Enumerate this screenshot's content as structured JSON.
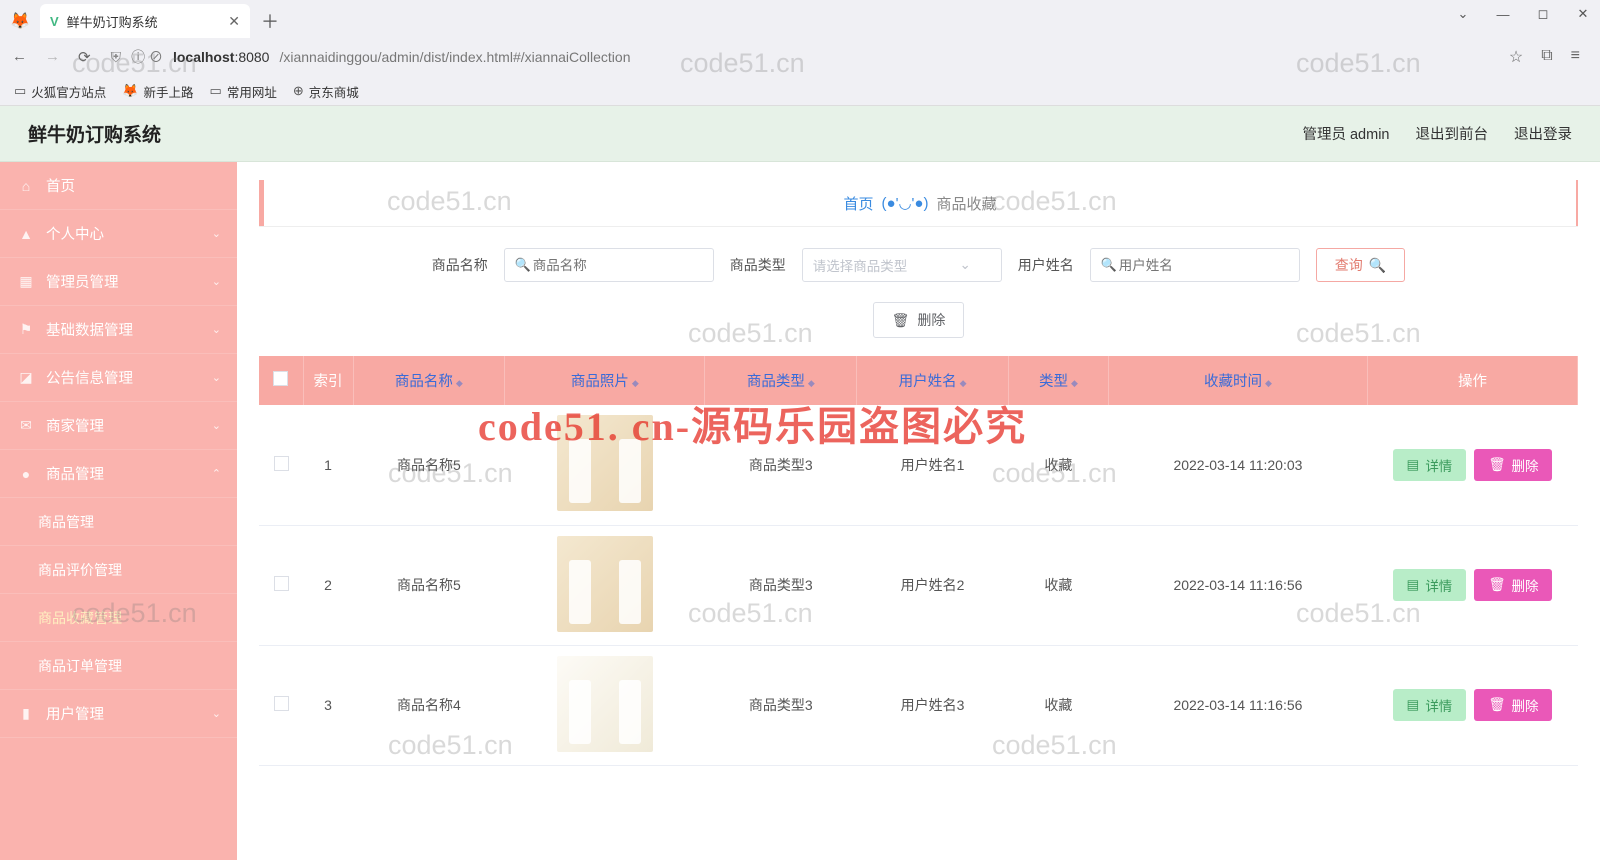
{
  "browser": {
    "tab_title": "鲜牛奶订购系统",
    "url_host": "localhost",
    "url_port": ":8080",
    "url_path": "/xiannaidinggou/admin/dist/index.html#/xiannaiCollection",
    "bookmarks": [
      "火狐官方站点",
      "新手上路",
      "常用网址",
      "京东商城"
    ]
  },
  "header": {
    "title": "鲜牛奶订购系统",
    "user": "管理员 admin",
    "to_front": "退出到前台",
    "logout": "退出登录"
  },
  "sidebar": {
    "items": [
      {
        "icon": "⌂",
        "label": "首页",
        "arrow": ""
      },
      {
        "icon": "👤",
        "label": "个人中心",
        "arrow": "⌄"
      },
      {
        "icon": "▦",
        "label": "管理员管理",
        "arrow": "⌄"
      },
      {
        "icon": "⚑",
        "label": "基础数据管理",
        "arrow": "⌄"
      },
      {
        "icon": "◪",
        "label": "公告信息管理",
        "arrow": "⌄"
      },
      {
        "icon": "✉",
        "label": "商家管理",
        "arrow": "⌄"
      },
      {
        "icon": "●",
        "label": "商品管理",
        "arrow": "⌃",
        "open": true
      },
      {
        "sub": true,
        "label": "商品管理"
      },
      {
        "sub": true,
        "label": "商品评价管理"
      },
      {
        "sub": true,
        "label": "商品收藏管理",
        "active": true
      },
      {
        "sub": true,
        "label": "商品订单管理"
      },
      {
        "icon": "▮",
        "label": "用户管理",
        "arrow": "⌄"
      }
    ]
  },
  "breadcrumb": {
    "home": "首页",
    "face": "(●'◡'●)",
    "current": "商品收藏"
  },
  "search": {
    "name_label": "商品名称",
    "name_ph": "商品名称",
    "type_label": "商品类型",
    "type_ph": "请选择商品类型",
    "user_label": "用户姓名",
    "user_ph": "用户姓名",
    "query_btn": "查询",
    "delete_btn": "删除"
  },
  "table": {
    "headers": [
      "索引",
      "商品名称",
      "商品照片",
      "商品类型",
      "用户姓名",
      "类型",
      "收藏时间",
      "操作"
    ],
    "detail_btn": "详情",
    "delete_btn": "删除",
    "rows": [
      {
        "idx": "1",
        "name": "商品名称5",
        "type": "商品类型3",
        "user": "用户姓名1",
        "kind": "收藏",
        "time": "2022-03-14 11:20:03"
      },
      {
        "idx": "2",
        "name": "商品名称5",
        "type": "商品类型3",
        "user": "用户姓名2",
        "kind": "收藏",
        "time": "2022-03-14 11:16:56"
      },
      {
        "idx": "3",
        "name": "商品名称4",
        "type": "商品类型3",
        "user": "用户姓名3",
        "kind": "收藏",
        "time": "2022-03-14 11:16:56"
      }
    ]
  },
  "watermarks": {
    "text": "code51.cn",
    "red": "code51. cn-源码乐园盗图必究"
  }
}
